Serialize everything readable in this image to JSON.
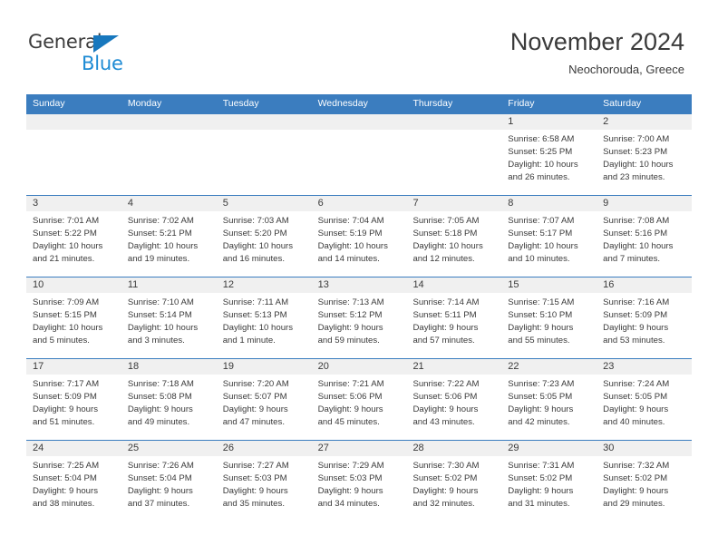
{
  "logo": {
    "word_top": "General",
    "word_bottom": "Blue",
    "triangle_color": "#1878be",
    "blue_color": "#1e8bd4"
  },
  "header": {
    "title": "November 2024",
    "subtitle": "Neochorouda, Greece"
  },
  "theme": {
    "header_blue": "#3b7dbf",
    "day_band_gray": "#f0f0f0",
    "text": "#3a3a3a"
  },
  "weekdays": [
    "Sunday",
    "Monday",
    "Tuesday",
    "Wednesday",
    "Thursday",
    "Friday",
    "Saturday"
  ],
  "weeks": [
    [
      {
        "day": "",
        "lines": []
      },
      {
        "day": "",
        "lines": []
      },
      {
        "day": "",
        "lines": []
      },
      {
        "day": "",
        "lines": []
      },
      {
        "day": "",
        "lines": []
      },
      {
        "day": "1",
        "lines": [
          "Sunrise: 6:58 AM",
          "Sunset: 5:25 PM",
          "Daylight: 10 hours",
          "and 26 minutes."
        ]
      },
      {
        "day": "2",
        "lines": [
          "Sunrise: 7:00 AM",
          "Sunset: 5:23 PM",
          "Daylight: 10 hours",
          "and 23 minutes."
        ]
      }
    ],
    [
      {
        "day": "3",
        "lines": [
          "Sunrise: 7:01 AM",
          "Sunset: 5:22 PM",
          "Daylight: 10 hours",
          "and 21 minutes."
        ]
      },
      {
        "day": "4",
        "lines": [
          "Sunrise: 7:02 AM",
          "Sunset: 5:21 PM",
          "Daylight: 10 hours",
          "and 19 minutes."
        ]
      },
      {
        "day": "5",
        "lines": [
          "Sunrise: 7:03 AM",
          "Sunset: 5:20 PM",
          "Daylight: 10 hours",
          "and 16 minutes."
        ]
      },
      {
        "day": "6",
        "lines": [
          "Sunrise: 7:04 AM",
          "Sunset: 5:19 PM",
          "Daylight: 10 hours",
          "and 14 minutes."
        ]
      },
      {
        "day": "7",
        "lines": [
          "Sunrise: 7:05 AM",
          "Sunset: 5:18 PM",
          "Daylight: 10 hours",
          "and 12 minutes."
        ]
      },
      {
        "day": "8",
        "lines": [
          "Sunrise: 7:07 AM",
          "Sunset: 5:17 PM",
          "Daylight: 10 hours",
          "and 10 minutes."
        ]
      },
      {
        "day": "9",
        "lines": [
          "Sunrise: 7:08 AM",
          "Sunset: 5:16 PM",
          "Daylight: 10 hours",
          "and 7 minutes."
        ]
      }
    ],
    [
      {
        "day": "10",
        "lines": [
          "Sunrise: 7:09 AM",
          "Sunset: 5:15 PM",
          "Daylight: 10 hours",
          "and 5 minutes."
        ]
      },
      {
        "day": "11",
        "lines": [
          "Sunrise: 7:10 AM",
          "Sunset: 5:14 PM",
          "Daylight: 10 hours",
          "and 3 minutes."
        ]
      },
      {
        "day": "12",
        "lines": [
          "Sunrise: 7:11 AM",
          "Sunset: 5:13 PM",
          "Daylight: 10 hours",
          "and 1 minute."
        ]
      },
      {
        "day": "13",
        "lines": [
          "Sunrise: 7:13 AM",
          "Sunset: 5:12 PM",
          "Daylight: 9 hours",
          "and 59 minutes."
        ]
      },
      {
        "day": "14",
        "lines": [
          "Sunrise: 7:14 AM",
          "Sunset: 5:11 PM",
          "Daylight: 9 hours",
          "and 57 minutes."
        ]
      },
      {
        "day": "15",
        "lines": [
          "Sunrise: 7:15 AM",
          "Sunset: 5:10 PM",
          "Daylight: 9 hours",
          "and 55 minutes."
        ]
      },
      {
        "day": "16",
        "lines": [
          "Sunrise: 7:16 AM",
          "Sunset: 5:09 PM",
          "Daylight: 9 hours",
          "and 53 minutes."
        ]
      }
    ],
    [
      {
        "day": "17",
        "lines": [
          "Sunrise: 7:17 AM",
          "Sunset: 5:09 PM",
          "Daylight: 9 hours",
          "and 51 minutes."
        ]
      },
      {
        "day": "18",
        "lines": [
          "Sunrise: 7:18 AM",
          "Sunset: 5:08 PM",
          "Daylight: 9 hours",
          "and 49 minutes."
        ]
      },
      {
        "day": "19",
        "lines": [
          "Sunrise: 7:20 AM",
          "Sunset: 5:07 PM",
          "Daylight: 9 hours",
          "and 47 minutes."
        ]
      },
      {
        "day": "20",
        "lines": [
          "Sunrise: 7:21 AM",
          "Sunset: 5:06 PM",
          "Daylight: 9 hours",
          "and 45 minutes."
        ]
      },
      {
        "day": "21",
        "lines": [
          "Sunrise: 7:22 AM",
          "Sunset: 5:06 PM",
          "Daylight: 9 hours",
          "and 43 minutes."
        ]
      },
      {
        "day": "22",
        "lines": [
          "Sunrise: 7:23 AM",
          "Sunset: 5:05 PM",
          "Daylight: 9 hours",
          "and 42 minutes."
        ]
      },
      {
        "day": "23",
        "lines": [
          "Sunrise: 7:24 AM",
          "Sunset: 5:05 PM",
          "Daylight: 9 hours",
          "and 40 minutes."
        ]
      }
    ],
    [
      {
        "day": "24",
        "lines": [
          "Sunrise: 7:25 AM",
          "Sunset: 5:04 PM",
          "Daylight: 9 hours",
          "and 38 minutes."
        ]
      },
      {
        "day": "25",
        "lines": [
          "Sunrise: 7:26 AM",
          "Sunset: 5:04 PM",
          "Daylight: 9 hours",
          "and 37 minutes."
        ]
      },
      {
        "day": "26",
        "lines": [
          "Sunrise: 7:27 AM",
          "Sunset: 5:03 PM",
          "Daylight: 9 hours",
          "and 35 minutes."
        ]
      },
      {
        "day": "27",
        "lines": [
          "Sunrise: 7:29 AM",
          "Sunset: 5:03 PM",
          "Daylight: 9 hours",
          "and 34 minutes."
        ]
      },
      {
        "day": "28",
        "lines": [
          "Sunrise: 7:30 AM",
          "Sunset: 5:02 PM",
          "Daylight: 9 hours",
          "and 32 minutes."
        ]
      },
      {
        "day": "29",
        "lines": [
          "Sunrise: 7:31 AM",
          "Sunset: 5:02 PM",
          "Daylight: 9 hours",
          "and 31 minutes."
        ]
      },
      {
        "day": "30",
        "lines": [
          "Sunrise: 7:32 AM",
          "Sunset: 5:02 PM",
          "Daylight: 9 hours",
          "and 29 minutes."
        ]
      }
    ]
  ]
}
